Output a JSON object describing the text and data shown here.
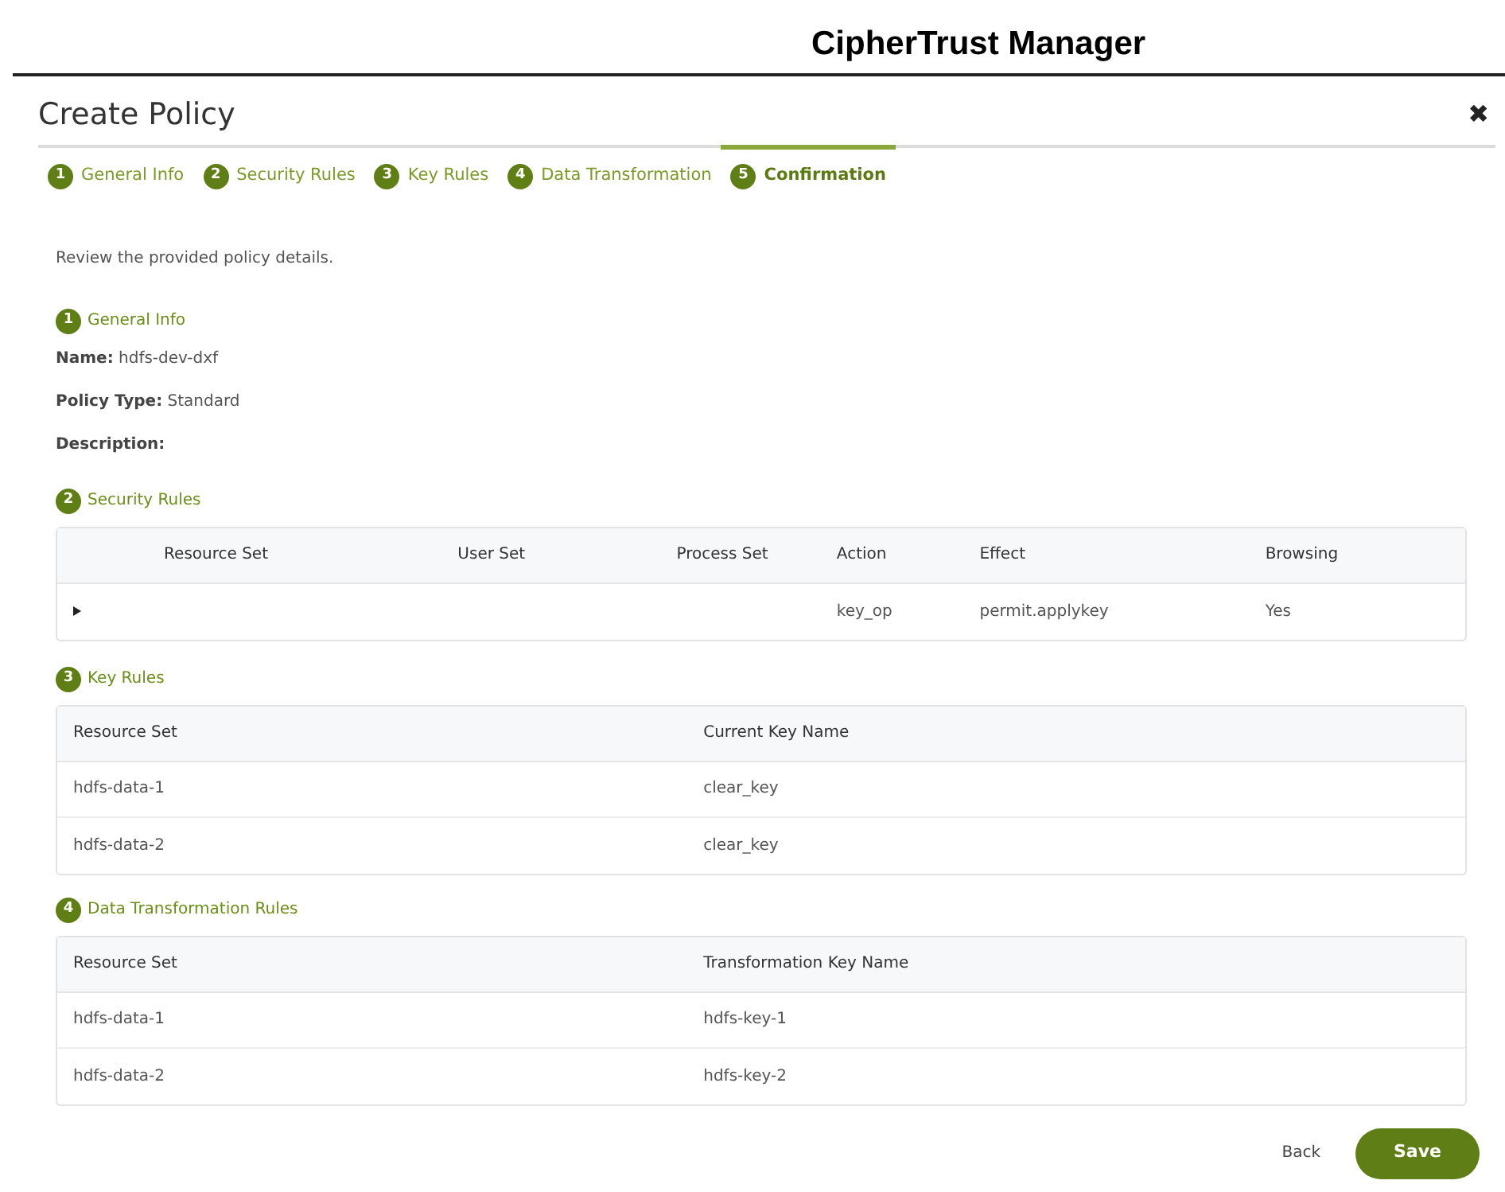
{
  "app_title": "CipherTrust Manager",
  "dialog": {
    "title": "Create Policy",
    "close": "✖"
  },
  "steps": [
    {
      "number": "1",
      "label": "General Info",
      "selected": false
    },
    {
      "number": "2",
      "label": "Security Rules",
      "selected": false
    },
    {
      "number": "3",
      "label": "Key Rules",
      "selected": false
    },
    {
      "number": "4",
      "label": "Data Transformation",
      "selected": false
    },
    {
      "number": "5",
      "label": "Confirmation",
      "selected": true
    }
  ],
  "intro": "Review the provided policy details.",
  "sections": [
    {
      "number": "1",
      "title": "General Info",
      "kind": "fields",
      "fields": [
        {
          "label": "Name:",
          "value": "hdfs-dev-dxf"
        },
        {
          "label": "Policy Type:",
          "value": "Standard"
        },
        {
          "label": "Description:"
        }
      ]
    },
    {
      "number": "2",
      "title": "Security Rules",
      "kind": "expandable",
      "columns": [
        "Resource Set",
        "User Set",
        "Process Set",
        "Action",
        "Effect",
        "Browsing"
      ],
      "rows": [
        {
          "expanded": false,
          "cells": [
            "",
            "",
            "",
            "key_op",
            "permit.applykey",
            "Yes"
          ]
        }
      ]
    },
    {
      "number": "3",
      "title": "Key Rules",
      "kind": "table",
      "columns": [
        "Resource Set",
        "Current Key Name"
      ],
      "rows": [
        {
          "cells": [
            "hdfs-data-1",
            "clear_key"
          ]
        },
        {
          "cells": [
            "hdfs-data-2",
            "clear_key"
          ]
        }
      ]
    },
    {
      "number": "4",
      "title": "Data Transformation Rules",
      "kind": "table",
      "columns": [
        "Resource Set",
        "Transformation Key Name"
      ],
      "rows": [
        {
          "cells": [
            "hdfs-data-1",
            "hdfs-key-1"
          ]
        },
        {
          "cells": [
            "hdfs-data-2",
            "hdfs-key-2"
          ]
        }
      ]
    }
  ],
  "buttons": [
    {
      "label": "Back",
      "kind": "link"
    },
    {
      "label": "Save",
      "kind": "primary"
    }
  ]
}
